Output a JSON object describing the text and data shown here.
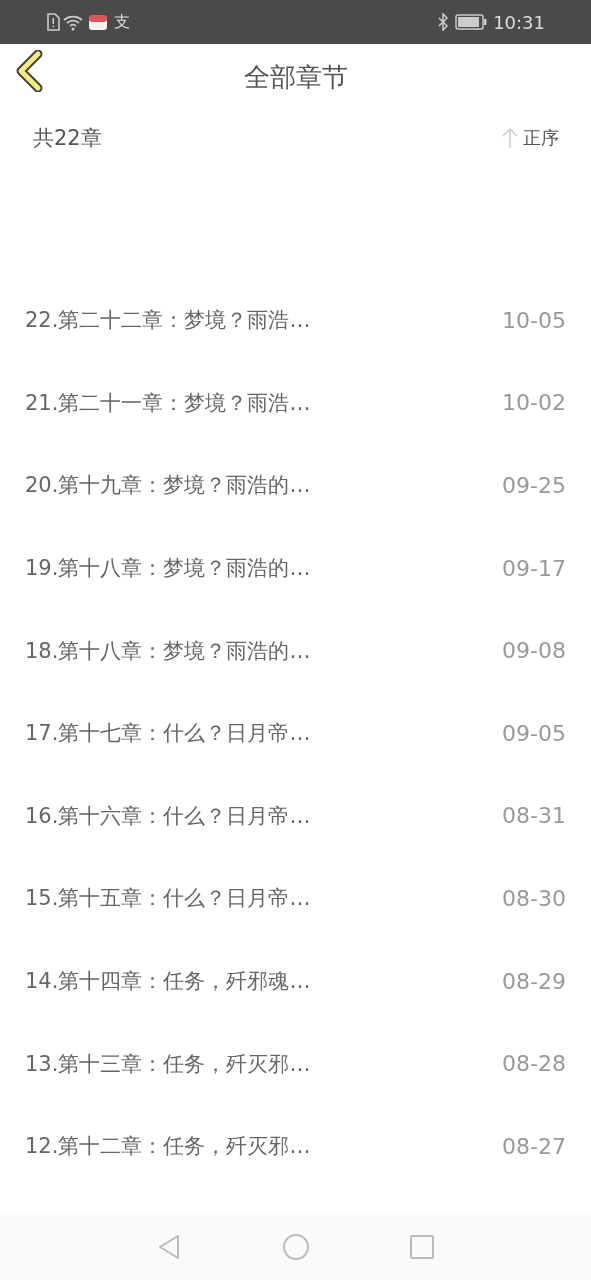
{
  "status_bar": {
    "app_glyph": "支",
    "time": "10:31"
  },
  "header": {
    "title": "全部章节"
  },
  "summary": {
    "count": "共22章",
    "sort_label": "正序"
  },
  "chapters": [
    {
      "title": "22.第二十二章：梦境？雨浩…",
      "date": "10-05"
    },
    {
      "title": "21.第二十一章：梦境？雨浩…",
      "date": "10-02"
    },
    {
      "title": "20.第十九章：梦境？雨浩的…",
      "date": "09-25"
    },
    {
      "title": "19.第十八章：梦境？雨浩的…",
      "date": "09-17"
    },
    {
      "title": "18.第十八章：梦境？雨浩的…",
      "date": "09-08"
    },
    {
      "title": "17.第十七章：什么？日月帝…",
      "date": "09-05"
    },
    {
      "title": "16.第十六章：什么？日月帝…",
      "date": "08-31"
    },
    {
      "title": "15.第十五章：什么？日月帝…",
      "date": "08-30"
    },
    {
      "title": "14.第十四章：任务，歼邪魂…",
      "date": "08-29"
    },
    {
      "title": "13.第十三章：任务，歼灭邪…",
      "date": "08-28"
    },
    {
      "title": "12.第十二章：任务，歼灭邪…",
      "date": "08-27"
    }
  ]
}
